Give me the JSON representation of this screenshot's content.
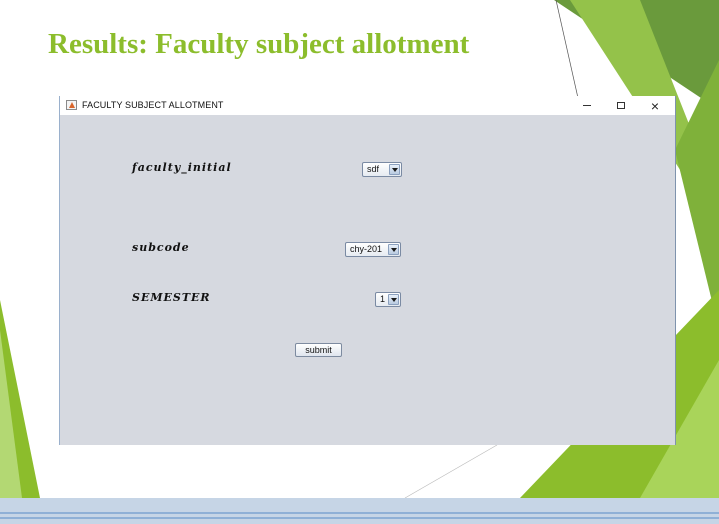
{
  "slide": {
    "title": "Results: Faculty subject allotment",
    "title_color": "#8cbd2c",
    "accent_colors": [
      "#5a8f2a",
      "#8cbd2c",
      "#a5d04a"
    ]
  },
  "window": {
    "title": "FACULTY SUBJECT ALLOTMENT",
    "icon": "java-app-icon",
    "controls": {
      "minimize": "minimize-icon",
      "maximize": "maximize-icon",
      "close": "×"
    }
  },
  "form": {
    "faculty_initial": {
      "label": "faculty_initial",
      "value": "sdf"
    },
    "subcode": {
      "label": "subcode",
      "value": "chy-201"
    },
    "semester": {
      "label": "SEMESTER",
      "value": "1"
    },
    "submit_label": "submit"
  }
}
